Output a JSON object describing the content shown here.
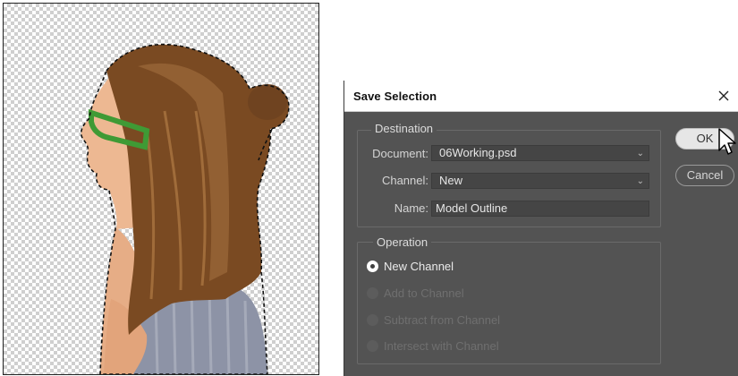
{
  "dialog": {
    "title": "Save Selection",
    "close_icon": "close-icon",
    "destination": {
      "legend": "Destination",
      "document_label": "Document:",
      "document_value": "06Working.psd",
      "channel_label": "Channel:",
      "channel_value": "New",
      "name_label": "Name:",
      "name_value": "Model Outline"
    },
    "operation": {
      "legend": "Operation",
      "options": [
        {
          "label": "New Channel",
          "selected": true,
          "enabled": true
        },
        {
          "label": "Add to Channel",
          "selected": false,
          "enabled": false
        },
        {
          "label": "Subtract from Channel",
          "selected": false,
          "enabled": false
        },
        {
          "label": "Intersect with Channel",
          "selected": false,
          "enabled": false
        }
      ]
    },
    "buttons": {
      "ok": "OK",
      "cancel": "Cancel"
    }
  },
  "colors": {
    "dialog_bg": "#535353",
    "hair": "#7a4a22",
    "glasses": "#3f9a35",
    "skin": "#e9b48f",
    "shirt": "#8d93a6"
  }
}
